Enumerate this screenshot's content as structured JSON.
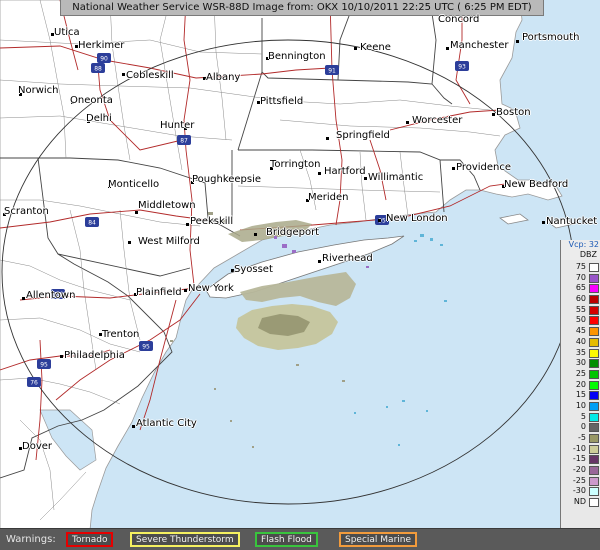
{
  "header": {
    "title": "National Weather Service WSR-88D Image from: OKX 10/10/2011 22:25 UTC ( 6:25 PM EDT)"
  },
  "map": {
    "cities": [
      {
        "name": "Utica"
      },
      {
        "name": "Herkimer"
      },
      {
        "name": "Bennington"
      },
      {
        "name": "Keene"
      },
      {
        "name": "Concord"
      },
      {
        "name": "Manchester"
      },
      {
        "name": "Portsmouth"
      },
      {
        "name": "Norwich"
      },
      {
        "name": "Oneonta"
      },
      {
        "name": "Cobleskill"
      },
      {
        "name": "Albany"
      },
      {
        "name": "Pittsfield"
      },
      {
        "name": "Delhi"
      },
      {
        "name": "Hunter"
      },
      {
        "name": "Springfield"
      },
      {
        "name": "Worcester"
      },
      {
        "name": "Boston"
      },
      {
        "name": "Torrington"
      },
      {
        "name": "Hartford"
      },
      {
        "name": "Providence"
      },
      {
        "name": "Willimantic"
      },
      {
        "name": "Monticello"
      },
      {
        "name": "Poughkeepsie"
      },
      {
        "name": "New Bedford"
      },
      {
        "name": "Middletown"
      },
      {
        "name": "Meriden"
      },
      {
        "name": "Scranton"
      },
      {
        "name": "New London"
      },
      {
        "name": "Nantucket"
      },
      {
        "name": "Peekskill"
      },
      {
        "name": "Bridgeport"
      },
      {
        "name": "West Milford"
      },
      {
        "name": "Syosset"
      },
      {
        "name": "Riverhead"
      },
      {
        "name": "Allentown"
      },
      {
        "name": "Plainfield"
      },
      {
        "name": "New York"
      },
      {
        "name": "Trenton"
      },
      {
        "name": "Philadelphia"
      },
      {
        "name": "Atlantic City"
      },
      {
        "name": "Dover"
      }
    ],
    "highway_shields": [
      "90",
      "88",
      "91",
      "93",
      "87",
      "84",
      "95",
      "78",
      "95",
      "76",
      "95"
    ]
  },
  "legend": {
    "mode": "Vcp: 32",
    "unit": "DBZ",
    "levels": [
      {
        "label": "75",
        "color": "#ffffff"
      },
      {
        "label": "70",
        "color": "#9955c9"
      },
      {
        "label": "65",
        "color": "#f800fd"
      },
      {
        "label": "60",
        "color": "#bc0000"
      },
      {
        "label": "55",
        "color": "#d40000"
      },
      {
        "label": "50",
        "color": "#fe0000"
      },
      {
        "label": "45",
        "color": "#fd9500"
      },
      {
        "label": "40",
        "color": "#e5bc00"
      },
      {
        "label": "35",
        "color": "#fdf802"
      },
      {
        "label": "30",
        "color": "#008e00"
      },
      {
        "label": "25",
        "color": "#01c501"
      },
      {
        "label": "20",
        "color": "#02fd02"
      },
      {
        "label": "15",
        "color": "#0300f4"
      },
      {
        "label": "10",
        "color": "#019ff4"
      },
      {
        "label": "5",
        "color": "#04e9e7"
      },
      {
        "label": "0",
        "color": "#646464"
      },
      {
        "label": "-5",
        "color": "#999966"
      },
      {
        "label": "-10",
        "color": "#cccc99"
      },
      {
        "label": "-15",
        "color": "#663366"
      },
      {
        "label": "-20",
        "color": "#996699"
      },
      {
        "label": "-25",
        "color": "#cc99cc"
      },
      {
        "label": "-30",
        "color": "#ccffff"
      },
      {
        "label": "ND",
        "color": "#ffffff"
      }
    ]
  },
  "warnings": {
    "title": "Warnings:",
    "items": [
      {
        "label": "Tornado",
        "color": "#e60000"
      },
      {
        "label": "Severe Thunderstorm",
        "color": "#f5f060"
      },
      {
        "label": "Flash Flood",
        "color": "#39c43d"
      },
      {
        "label": "Special Marine",
        "color": "#f29b3c"
      }
    ]
  }
}
